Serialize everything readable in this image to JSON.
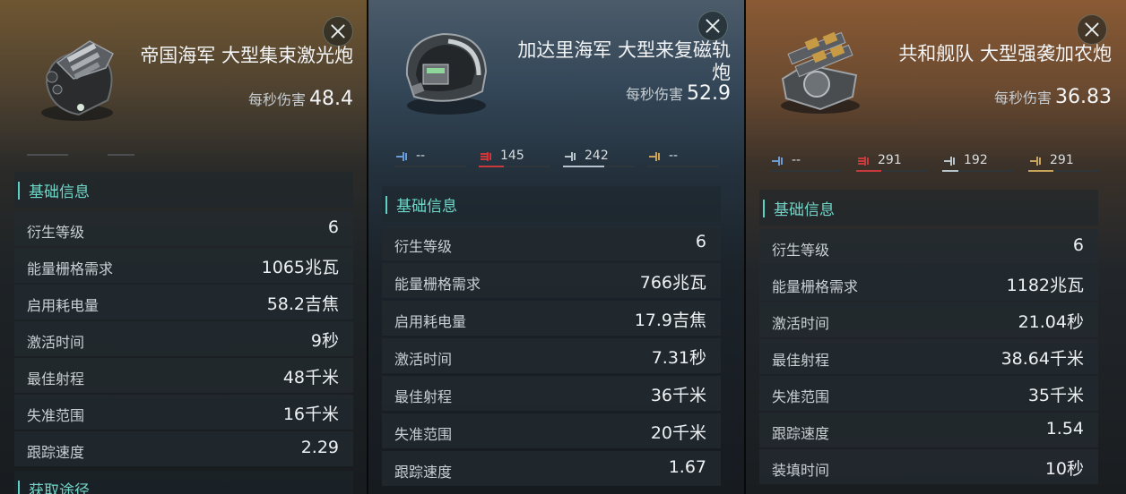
{
  "panels": [
    {
      "title": "帝国海军 大型集束激光炮",
      "dps_label": "每秒伤害",
      "dps_value": "48.4",
      "close_icon": "close-icon",
      "accent": "#6fd6c8",
      "section_title": "基础信息",
      "stats": [
        {
          "label": "衍生等级",
          "value": "6"
        },
        {
          "label": "能量栅格需求",
          "value": "1065兆瓦"
        },
        {
          "label": "启用耗电量",
          "value": "58.2吉焦"
        },
        {
          "label": "激活时间",
          "value": "9秒"
        },
        {
          "label": "最佳射程",
          "value": "48千米"
        },
        {
          "label": "失准范围",
          "value": "16千米"
        },
        {
          "label": "跟踪速度",
          "value": "2.29"
        }
      ],
      "next_section_title": "获取途径"
    },
    {
      "title": "加达里海军 大型来复磁轨炮",
      "dps_label": "每秒伤害",
      "dps_value": "52.9",
      "close_icon": "close-icon",
      "damage": [
        {
          "icon": "em-damage-icon",
          "value": "--",
          "fill": 0,
          "color": "#6a9bd6"
        },
        {
          "icon": "thermal-damage-icon",
          "value": "145",
          "fill": 0.35,
          "color": "#c9393c"
        },
        {
          "icon": "kinetic-damage-icon",
          "value": "242",
          "fill": 0.58,
          "color": "#b8c4cc"
        },
        {
          "icon": "explosive-damage-icon",
          "value": "--",
          "fill": 0,
          "color": "#c9a35a"
        }
      ],
      "section_title": "基础信息",
      "stats": [
        {
          "label": "衍生等级",
          "value": "6"
        },
        {
          "label": "能量栅格需求",
          "value": "766兆瓦"
        },
        {
          "label": "启用耗电量",
          "value": "17.9吉焦"
        },
        {
          "label": "激活时间",
          "value": "7.31秒"
        },
        {
          "label": "最佳射程",
          "value": "36千米"
        },
        {
          "label": "失准范围",
          "value": "20千米"
        },
        {
          "label": "跟踪速度",
          "value": "1.67"
        }
      ]
    },
    {
      "title": "共和舰队 大型强袭加农炮",
      "dps_label": "每秒伤害",
      "dps_value": "36.83",
      "close_icon": "close-icon",
      "damage": [
        {
          "icon": "em-damage-icon",
          "value": "--",
          "fill": 0,
          "color": "#6a9bd6"
        },
        {
          "icon": "thermal-damage-icon",
          "value": "291",
          "fill": 0.35,
          "color": "#c9393c"
        },
        {
          "icon": "kinetic-damage-icon",
          "value": "192",
          "fill": 0.23,
          "color": "#b8c4cc"
        },
        {
          "icon": "explosive-damage-icon",
          "value": "291",
          "fill": 0.35,
          "color": "#c9a35a"
        }
      ],
      "section_title": "基础信息",
      "stats": [
        {
          "label": "衍生等级",
          "value": "6"
        },
        {
          "label": "能量栅格需求",
          "value": "1182兆瓦"
        },
        {
          "label": "激活时间",
          "value": "21.04秒"
        },
        {
          "label": "最佳射程",
          "value": "38.64千米"
        },
        {
          "label": "失准范围",
          "value": "35千米"
        },
        {
          "label": "跟踪速度",
          "value": "1.54"
        },
        {
          "label": "装填时间",
          "value": "10秒"
        }
      ]
    }
  ]
}
